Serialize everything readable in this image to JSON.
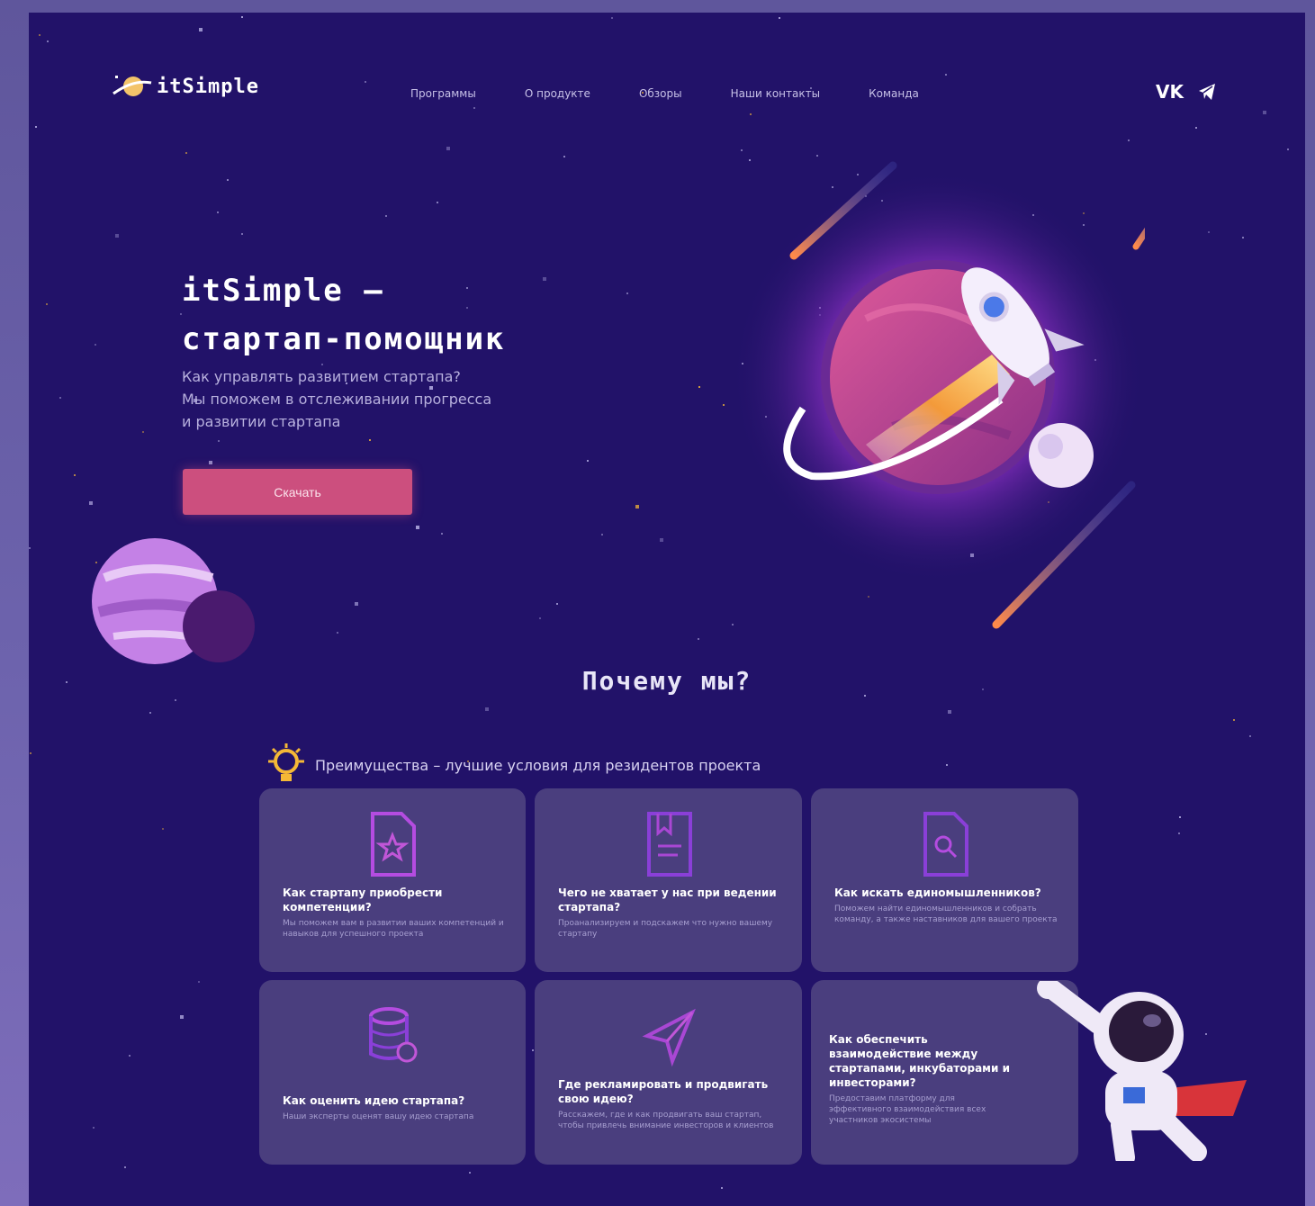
{
  "brand": {
    "name": "itSimple"
  },
  "nav": {
    "items": [
      "Программы",
      "О продукте",
      "Обзоры",
      "Наши контакты",
      "Команда"
    ]
  },
  "social": {
    "vk": "VK",
    "telegram": "telegram"
  },
  "hero": {
    "title_line1": "itSimple –",
    "title_line2": "стартап-помощник",
    "subtitle_line1": "Как управлять развитием стартапа?",
    "subtitle_line2": "Мы поможем в отслеживании прогресса",
    "subtitle_line3": "и развитии стартапа",
    "cta_label": "Скачать"
  },
  "why": {
    "title": "Почему мы?",
    "advantages_text": "Преимущества – лучшие условия для резидентов проекта",
    "cards": [
      {
        "icon": "document-star-icon",
        "question": "Как стартапу приобрести компетенции?",
        "answer": "Мы поможем вам в развитии ваших компетенций и навыков для успешного проекта"
      },
      {
        "icon": "document-bookmark-icon",
        "question": "Чего не хватает у нас при ведении стартапа?",
        "answer": "Проанализируем и подскажем что нужно вашему стартапу"
      },
      {
        "icon": "document-search-icon",
        "question": "Как искать единомышленников?",
        "answer": "Поможем найти единомышленников и собрать команду, а также наставников для вашего проекта"
      },
      {
        "icon": "database-check-icon",
        "question": "Как оценить идею стартапа?",
        "answer": "Наши эксперты оценят вашу идею стартапа"
      },
      {
        "icon": "send-icon",
        "question": "Где рекламировать и продвигать свою идею?",
        "answer": "Расскажем, где и как продвигать ваш стартап, чтобы привлечь внимание инвесторов и клиентов"
      },
      {
        "icon": "none",
        "question": "Как обеспечить взаимодействие между стартапами, инкубаторами и инвесторами?",
        "answer": "Предоставим платформу для эффективного взаимодействия всех участников экосистемы"
      }
    ]
  },
  "colors": {
    "background": "#221269",
    "card": "#4a3e7e",
    "accent": "#cc4f7e",
    "planet": "#b43b86",
    "glow": "#9a3ad0"
  }
}
